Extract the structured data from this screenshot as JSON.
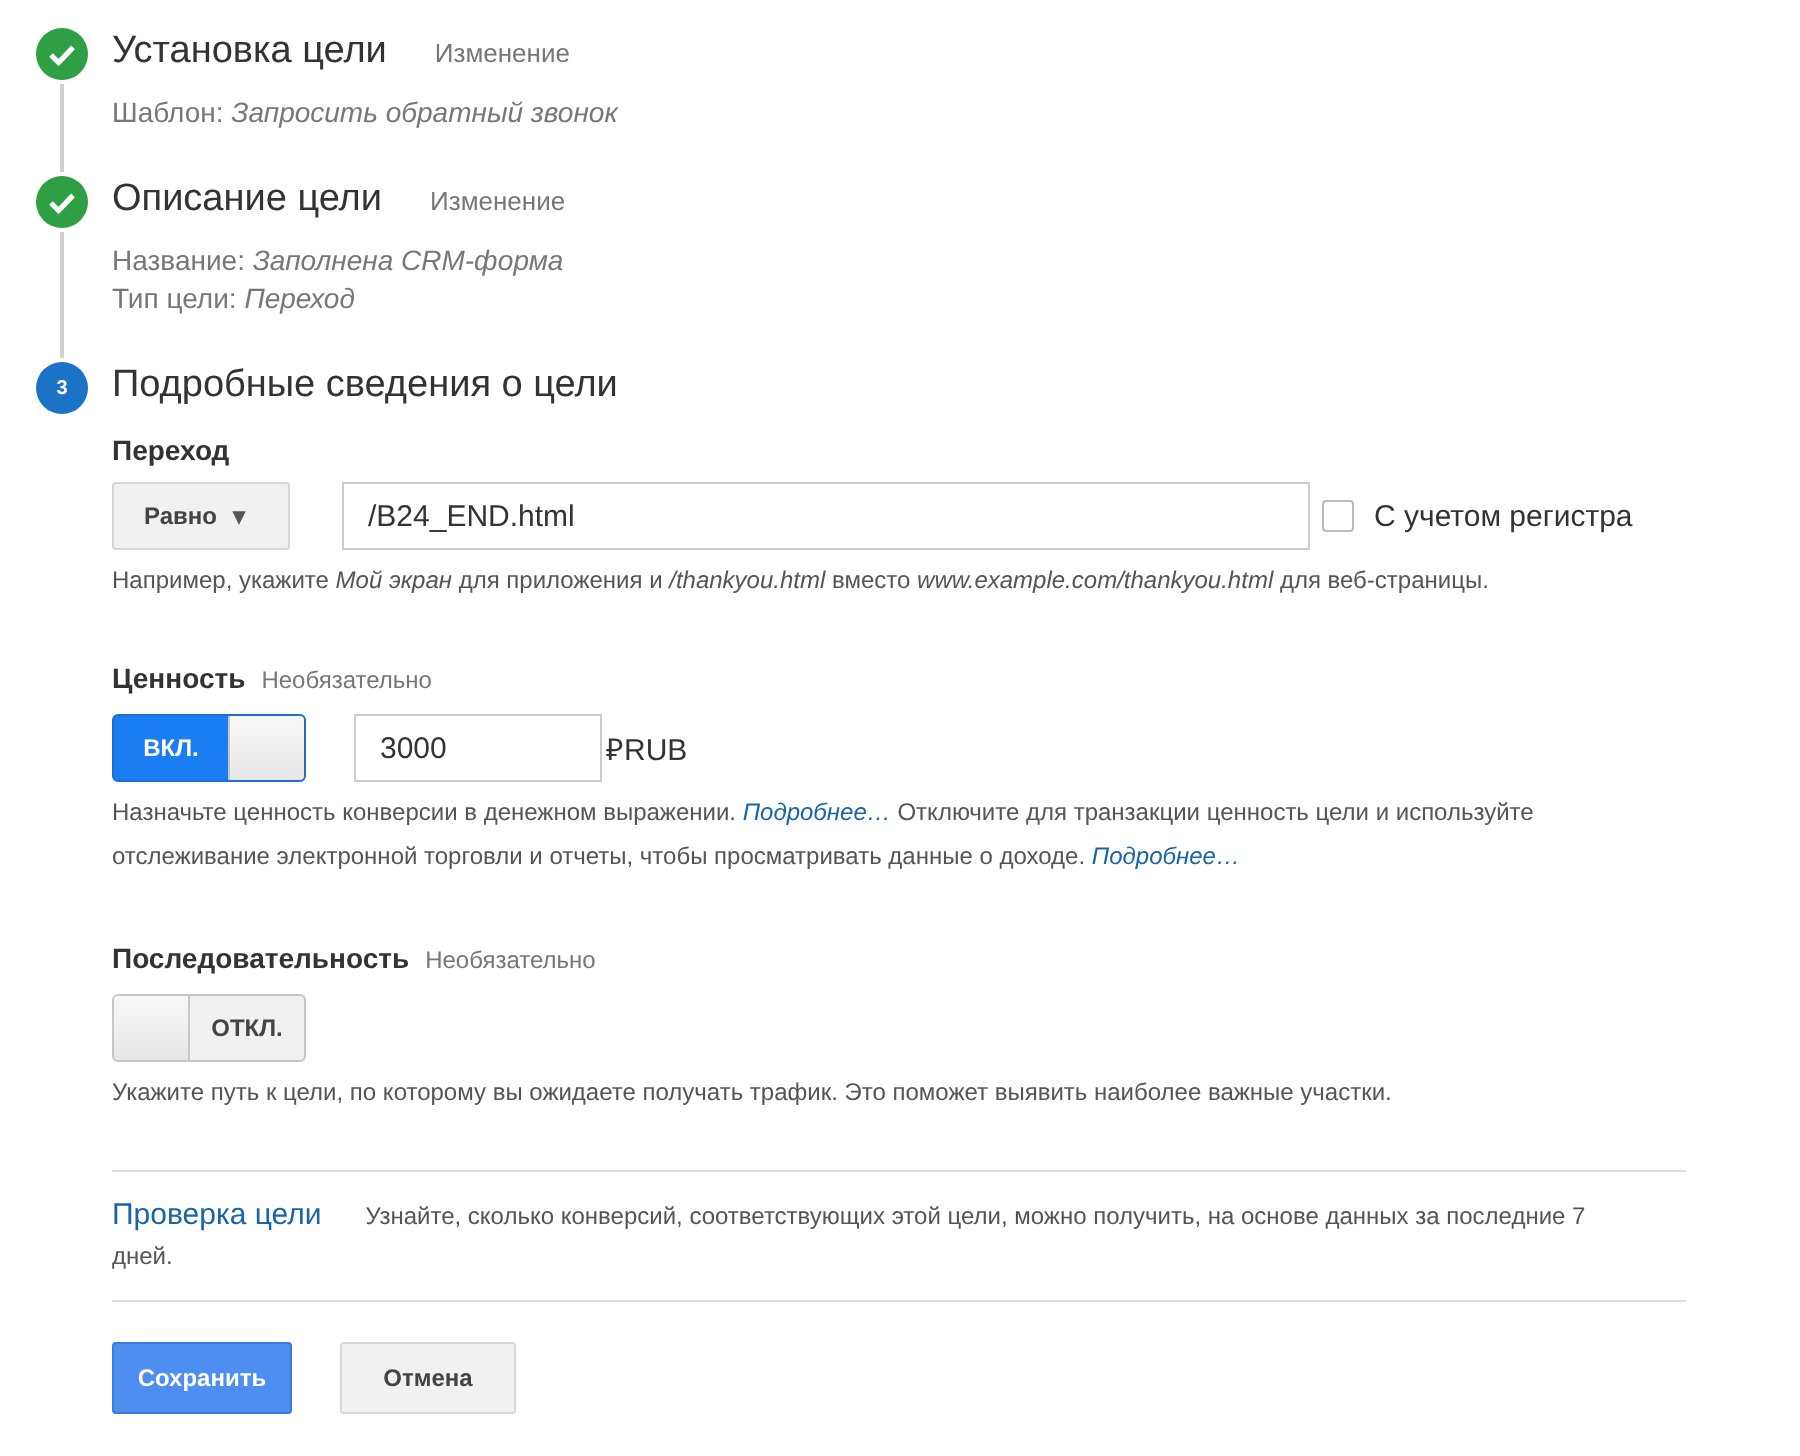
{
  "steps": [
    {
      "kind": "done",
      "title": "Установка цели",
      "edit": "Изменение",
      "details": [
        {
          "label": "Шаблон:",
          "value": "Запросить обратный звонок"
        }
      ]
    },
    {
      "kind": "done",
      "title": "Описание цели",
      "edit": "Изменение",
      "details": [
        {
          "label": "Название:",
          "value": "Заполнена CRM-форма"
        },
        {
          "label": "Тип цели:",
          "value": "Переход"
        }
      ]
    },
    {
      "kind": "current",
      "number": "3",
      "title": "Подробные сведения о цели"
    }
  ],
  "destination": {
    "label": "Переход",
    "match": "Равно",
    "match_caret": "▾",
    "value": "/B24_END.html",
    "case_sensitive": {
      "label": "С учетом регистра",
      "checked": false
    },
    "hint": "Например, укажите *Мой экран* для приложения и */thankyou.html* вместо *www.example.com/thankyou.html* для веб-страницы."
  },
  "value": {
    "label": "Ценность",
    "optional": "Необязательно",
    "toggle": {
      "on": true,
      "label": "ВКЛ."
    },
    "amount": "3000",
    "currency": "₽RUB",
    "help": [
      {
        "kind": "text",
        "text": "Назначьте ценность конверсии в денежном выражении. "
      },
      {
        "kind": "link",
        "text": "Подробнее…"
      },
      {
        "kind": "text",
        "text": " Отключите для транзакции ценность цели и используйте отслеживание электронной торговли и отчеты, чтобы просматривать данные о доходе. "
      },
      {
        "kind": "link",
        "text": "Подробнее…"
      }
    ]
  },
  "funnel": {
    "label": "Последовательность",
    "optional": "Необязательно",
    "toggle": {
      "on": false,
      "label": "ОТКЛ."
    },
    "help": "Укажите путь к цели, по которому вы ожидаете получать трафик. Это поможет выявить наиболее важные участки."
  },
  "verify": {
    "link": "Проверка цели",
    "text": "Узнайте, сколько конверсий, соответствующих этой цели, можно получить, на основе данных за последние 7 дней."
  },
  "buttons": [
    {
      "kind": "primary",
      "label": "Сохранить"
    },
    {
      "kind": "secondary",
      "label": "Отмена"
    }
  ]
}
